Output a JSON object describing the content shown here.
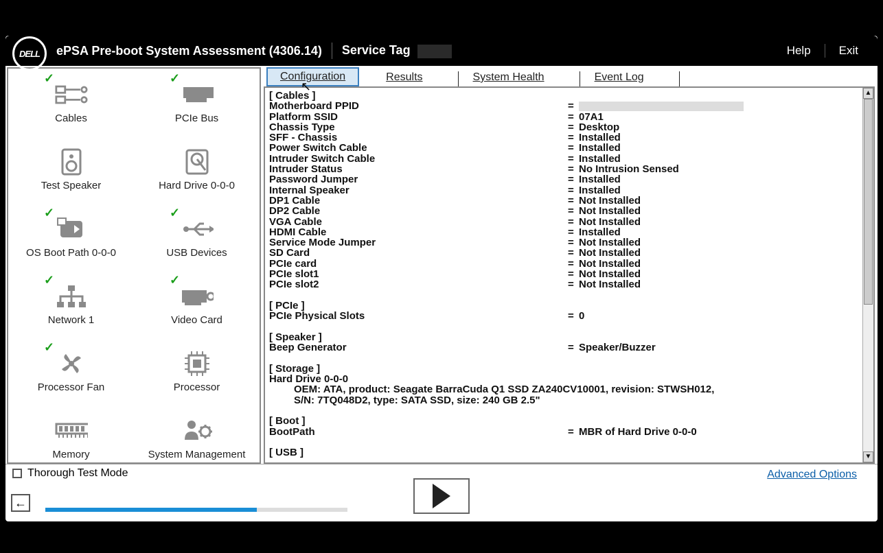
{
  "header": {
    "brand": "DELL",
    "title": "ePSA Pre-boot System Assessment (4306.14)",
    "service_tag_label": "Service Tag",
    "help": "Help",
    "exit": "Exit"
  },
  "devices": [
    {
      "name": "Cables",
      "checked": true,
      "icon": "cables"
    },
    {
      "name": "PCIe Bus",
      "checked": true,
      "icon": "pcie"
    },
    {
      "name": "Test Speaker",
      "checked": false,
      "icon": "speaker"
    },
    {
      "name": "Hard Drive 0-0-0",
      "checked": false,
      "icon": "hdd"
    },
    {
      "name": "OS Boot Path 0-0-0",
      "checked": true,
      "icon": "bootpath"
    },
    {
      "name": "USB Devices",
      "checked": true,
      "icon": "usb"
    },
    {
      "name": "Network 1",
      "checked": true,
      "icon": "network"
    },
    {
      "name": "Video Card",
      "checked": true,
      "icon": "video"
    },
    {
      "name": "Processor Fan",
      "checked": true,
      "icon": "fan"
    },
    {
      "name": "Processor",
      "checked": false,
      "icon": "cpu"
    },
    {
      "name": "Memory",
      "checked": false,
      "icon": "memory"
    },
    {
      "name": "System Management",
      "checked": false,
      "icon": "sysmgmt"
    }
  ],
  "tabs": {
    "configuration": "Configuration",
    "results": "Results",
    "system_health": "System Health",
    "event_log": "Event Log"
  },
  "config": {
    "sections": [
      {
        "title": "[ Cables ]",
        "rows": [
          {
            "label": "Motherboard PPID",
            "value": "__REDACTED__"
          },
          {
            "label": "Platform SSID",
            "value": "07A1"
          },
          {
            "label": "Chassis Type",
            "value": "Desktop"
          },
          {
            "label": "SFF - Chassis",
            "value": "Installed"
          },
          {
            "label": "Power Switch Cable",
            "value": "Installed"
          },
          {
            "label": "Intruder Switch Cable",
            "value": "Installed"
          },
          {
            "label": "Intruder Status",
            "value": "No Intrusion Sensed"
          },
          {
            "label": "Password Jumper",
            "value": "Installed"
          },
          {
            "label": "Internal Speaker",
            "value": "Installed"
          },
          {
            "label": "DP1 Cable",
            "value": "Not Installed"
          },
          {
            "label": "DP2 Cable",
            "value": "Not Installed"
          },
          {
            "label": "VGA Cable",
            "value": "Not Installed"
          },
          {
            "label": "HDMI Cable",
            "value": "Installed"
          },
          {
            "label": "Service Mode Jumper",
            "value": "Not Installed"
          },
          {
            "label": "SD Card",
            "value": "Not Installed"
          },
          {
            "label": "PCIe card",
            "value": "Not Installed"
          },
          {
            "label": "PCIe slot1",
            "value": "Not Installed"
          },
          {
            "label": "PCIe slot2",
            "value": "Not Installed"
          }
        ]
      },
      {
        "title": "[ PCIe ]",
        "rows": [
          {
            "label": "PCIe Physical Slots",
            "value": "0"
          }
        ]
      },
      {
        "title": "[ Speaker ]",
        "rows": [
          {
            "label": "Beep Generator",
            "value": "Speaker/Buzzer"
          }
        ]
      },
      {
        "title": "[ Storage ]",
        "freeform": [
          "Hard Drive 0-0-0",
          "OEM: ATA, product: Seagate BarraCuda Q1 SSD ZA240CV10001, revision: STWSH012,",
          "S/N: 7TQ048D2, type: SATA SSD, size: 240 GB 2.5\""
        ]
      },
      {
        "title": "[ Boot ]",
        "rows": [
          {
            "label": "BootPath",
            "value": "MBR of Hard Drive 0-0-0"
          }
        ]
      },
      {
        "title": "[ USB ]",
        "rows": []
      }
    ]
  },
  "footer": {
    "thorough": "Thorough Test Mode",
    "advanced": "Advanced Options",
    "progress_percent": 70
  }
}
